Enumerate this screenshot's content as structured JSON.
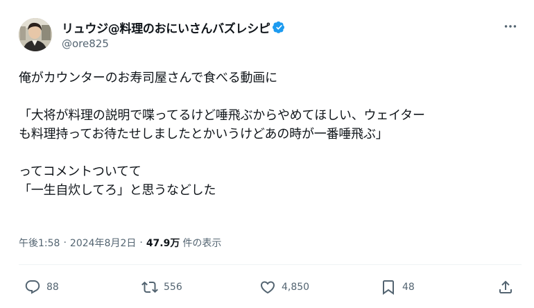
{
  "author": {
    "display_name": "リュウジ@料理のおにいさんバズレシピ",
    "handle": "@ore825"
  },
  "post": {
    "line1": "俺がカウンターのお寿司屋さんで食べる動画に",
    "line2": "「大将が料理の説明で喋ってるけど唾飛ぶからやめてほしい、ウェイター",
    "line3": "も料理持ってお待たせしましたとかいうけどあの時が一番唾飛ぶ」",
    "line4": "ってコメントついてて",
    "line5": "「一生自炊してろ」と思うなどした"
  },
  "meta": {
    "time": "午後1:58",
    "date": "2024年8月2日",
    "separator": "·",
    "views_count": "47.9万",
    "views_label": "件の表示"
  },
  "actions": {
    "replies": "88",
    "reposts": "556",
    "likes": "4,850",
    "bookmarks": "48"
  },
  "icons": {
    "verified": "verified-badge-icon",
    "more": "more-dots-icon",
    "reply": "reply-bubble-icon",
    "repost": "repost-arrows-icon",
    "like": "heart-icon",
    "bookmark": "bookmark-icon",
    "share": "share-upload-icon"
  },
  "colors": {
    "verified": "#1d9bf0",
    "text_primary": "#0f1419",
    "text_secondary": "#536471",
    "divider": "#eff3f4"
  }
}
